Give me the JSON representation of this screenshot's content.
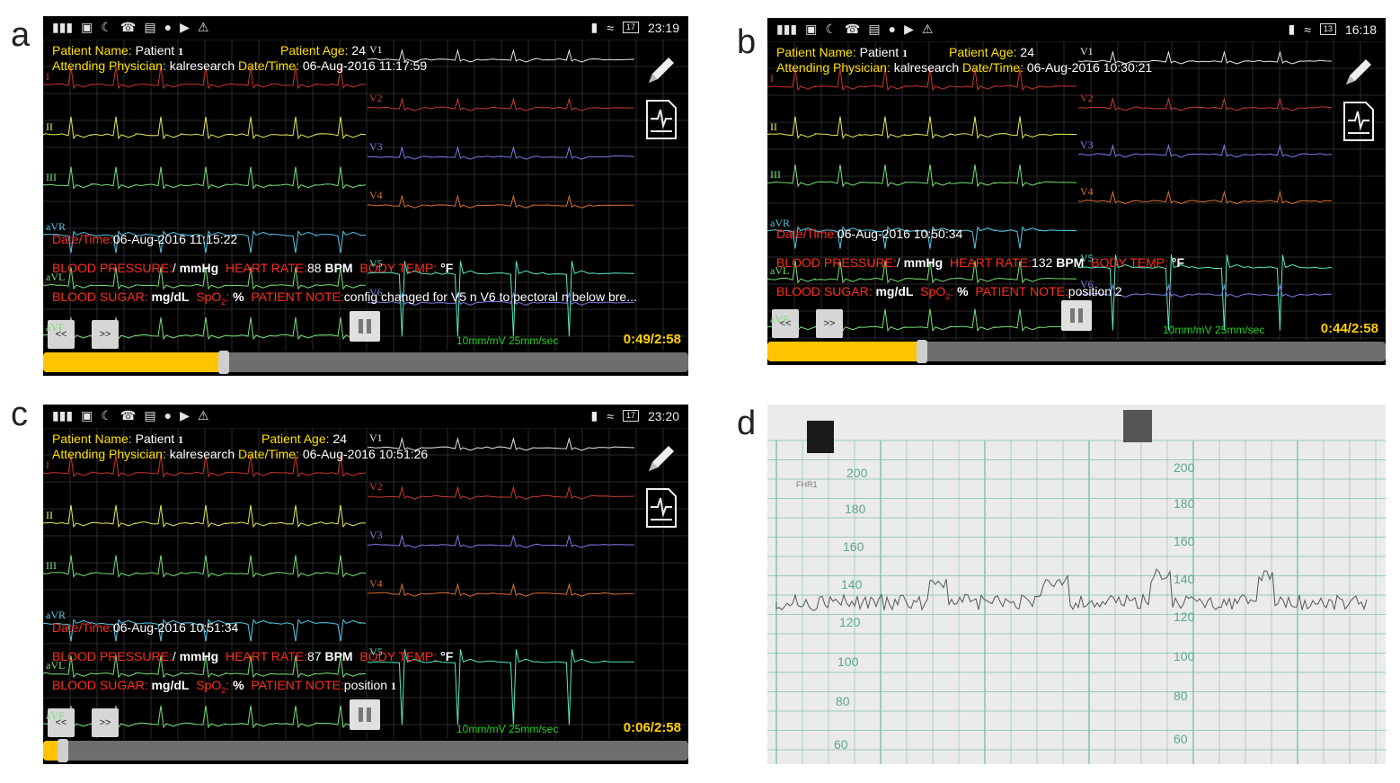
{
  "panels": [
    {
      "letter": "a",
      "clock": "23:19",
      "battery": "17",
      "patient_name_label": "Patient Name:",
      "patient_name": "Patient",
      "patient_num": "1",
      "patient_age_label": "Patient Age:",
      "patient_age": "24",
      "physician_label": "Attending Physician:",
      "physician": "kalresearch",
      "datetime_label": "Date/Time:",
      "datetime": "06-Aug-2016 11:17:59",
      "note_datetime_label": "Date/Time:",
      "note_datetime": "06-Aug-2016 11:15:22",
      "bp_label": "BLOOD PRESSURE:",
      "bp_value": "/",
      "bp_unit": "mmHg",
      "hr_label": "HEART RATE:",
      "hr_value": "88",
      "hr_unit": "BPM",
      "temp_label": "BODY TEMP:",
      "temp_unit": "°F",
      "sugar_label": "BLOOD SUGAR:",
      "sugar_unit": "mg/dL",
      "spo2_label": "SpO",
      "spo2_sub": "2",
      "spo2_colon": ":",
      "spo2_unit": "%",
      "note_label": "PATIENT NOTE:",
      "note": "config changed for V5 n V6 to pectoral n below bre...",
      "rewind": "<<",
      "forward": ">>",
      "scale": "10mm/mV 25mm/sec",
      "time": "0:49/2:58",
      "progress": 0.28,
      "leads_left": [
        "I",
        "II",
        "III",
        "aVR",
        "aVL",
        "aVF"
      ],
      "leads_right": [
        "V1",
        "V2",
        "V3",
        "V4",
        "V5",
        "V6"
      ]
    },
    {
      "letter": "b",
      "clock": "16:18",
      "battery": "13",
      "patient_name_label": "Patient Name:",
      "patient_name": "Patient",
      "patient_num": "1",
      "patient_age_label": "Patient Age:",
      "patient_age": "24",
      "physician_label": "Attending Physician:",
      "physician": "kalresearch",
      "datetime_label": "Date/Time:",
      "datetime": "06-Aug-2016 10:30:21",
      "note_datetime_label": "Date/Time:",
      "note_datetime": "06-Aug-2016 10:50:34",
      "bp_label": "BLOOD PRESSURE:",
      "bp_value": "/",
      "bp_unit": "mmHg",
      "hr_label": "HEART RATE:",
      "hr_value": "132",
      "hr_unit": "BPM",
      "temp_label": "BODY TEMP:",
      "temp_unit": "°F",
      "sugar_label": "BLOOD SUGAR:",
      "sugar_unit": "mg/dL",
      "spo2_label": "SpO",
      "spo2_sub": "2",
      "spo2_colon": ":",
      "spo2_unit": "%",
      "note_label": "PATIENT NOTE:",
      "note": "position 2",
      "rewind": "<<",
      "forward": ">>",
      "scale": "10mm/mV 25mm/sec",
      "time": "0:44/2:58",
      "progress": 0.25,
      "leads_left": [
        "I",
        "II",
        "III",
        "aVR",
        "aVL",
        "aVF"
      ],
      "leads_right": [
        "V1",
        "V2",
        "V3",
        "V4",
        "V5",
        "V6"
      ]
    },
    {
      "letter": "c",
      "clock": "23:20",
      "battery": "17",
      "patient_name_label": "Patient Name:",
      "patient_name": "Patient",
      "patient_num": "1",
      "patient_age_label": "Patient Age:",
      "patient_age": "24",
      "physician_label": "Attending Physician:",
      "physician": "kalresearch",
      "datetime_label": "Date/Time:",
      "datetime": "06-Aug-2016 10:51:26",
      "note_datetime_label": "Date/Time:",
      "note_datetime": "06-Aug-2016 10:51:34",
      "bp_label": "BLOOD PRESSURE:",
      "bp_value": "/",
      "bp_unit": "mmHg",
      "hr_label": "HEART RATE:",
      "hr_value": "87",
      "hr_unit": "BPM",
      "temp_label": "BODY TEMP:",
      "temp_unit": "°F",
      "sugar_label": "BLOOD SUGAR:",
      "sugar_unit": "mg/dL",
      "spo2_label": "SpO",
      "spo2_sub": "2",
      "spo2_colon": ":",
      "spo2_unit": "%",
      "note_label": "PATIENT NOTE:",
      "note": "position",
      "note_num": "1",
      "rewind": "<<",
      "forward": ">>",
      "scale": "10mm/mV 25mm/sec",
      "time": "0:06/2:58",
      "progress": 0.03,
      "leads_left": [
        "I",
        "II",
        "III",
        "aVR",
        "aVL",
        "aVF"
      ],
      "leads_right": [
        "V1",
        "V2",
        "V3",
        "V4",
        "V5"
      ]
    }
  ],
  "paper": {
    "letter": "d",
    "label": "FHR1",
    "left_ticks": [
      "200",
      "180",
      "160",
      "140",
      "120",
      "100",
      "80",
      "60"
    ],
    "right_ticks": [
      "200",
      "180",
      "160",
      "140",
      "120",
      "100",
      "80",
      "60"
    ]
  },
  "colors": {
    "lead_I": "#c8352a",
    "lead_II": "#e8e85a",
    "lead_III": "#78e078",
    "lead_aVR": "#58c8e8",
    "lead_V1": "#e8e8e8",
    "lead_V2": "#c83c30",
    "lead_V3": "#7c7ce8",
    "lead_V4": "#d87030",
    "lead_V5": "#58e8c8"
  }
}
